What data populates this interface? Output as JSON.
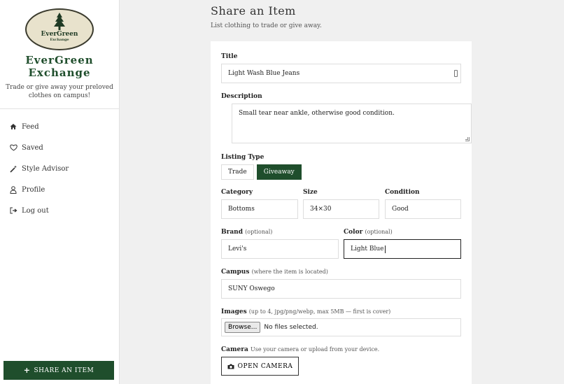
{
  "brand": {
    "logo_name": "EverGreen",
    "logo_sub": "Exchange",
    "title_line1": "EverGreen",
    "title_line2": "Exchange",
    "tagline": "Trade or give away your preloved clothes on campus!"
  },
  "nav": {
    "items": [
      {
        "label": "Feed",
        "icon": "home-icon"
      },
      {
        "label": "Saved",
        "icon": "heart-icon"
      },
      {
        "label": "Style Advisor",
        "icon": "magic-wand-icon"
      },
      {
        "label": "Profile",
        "icon": "user-icon"
      },
      {
        "label": "Log out",
        "icon": "logout-icon"
      }
    ],
    "share_label": "SHARE AN ITEM"
  },
  "page": {
    "title": "Share an Item",
    "subtitle": "List clothing to trade or give away."
  },
  "form": {
    "title_label": "Title",
    "title_value": "Light Wash Blue Jeans",
    "description_label": "Description",
    "description_value": "Small tear near ankle, otherwise good condition.",
    "listing_type_label": "Listing Type",
    "listing_options": [
      "Trade",
      "Giveaway"
    ],
    "listing_selected": "Giveaway",
    "category_label": "Category",
    "category_value": "Bottoms",
    "size_label": "Size",
    "size_value": "34×30",
    "condition_label": "Condition",
    "condition_value": "Good",
    "brand_label": "Brand",
    "brand_optional": "(optional)",
    "brand_value": "Levi's",
    "color_label": "Color",
    "color_optional": "(optional)",
    "color_value": "Light Blue",
    "campus_label": "Campus",
    "campus_hint": "(where the item is located)",
    "campus_value": "SUNY Oswego",
    "images_label": "Images",
    "images_hint": "(up to 4, jpg/png/webp, max 5MB — first is cover)",
    "browse_label": "Browse...",
    "file_status": "No files selected.",
    "camera_label": "Camera",
    "camera_hint": "Use your camera or upload from your device.",
    "open_camera_label": "OPEN CAMERA"
  },
  "colors": {
    "accent": "#1f4e2c",
    "background": "#f0f0f0"
  }
}
